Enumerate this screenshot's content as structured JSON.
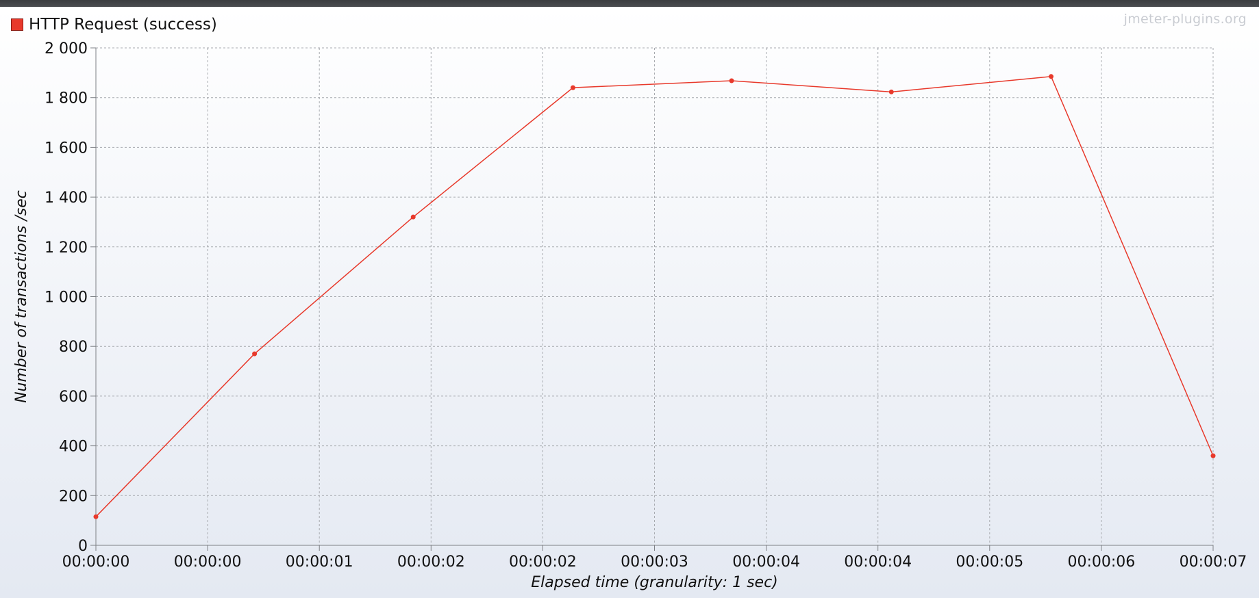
{
  "watermark": "jmeter-plugins.org",
  "colors": {
    "series": "#e8392b",
    "grid": "#a8abb0",
    "axis": "#7d8085",
    "plot_bg_top": "#ffffff",
    "plot_bg_bottom": "#e4e9f2"
  },
  "chart_data": {
    "type": "line",
    "title": "",
    "xlabel": "Elapsed time (granularity: 1 sec)",
    "ylabel": "Number of transactions /sec",
    "ylim": [
      0,
      2000
    ],
    "y_ticks": [
      "0",
      "200",
      "400",
      "600",
      "800",
      "1 000",
      "1 200",
      "1 400",
      "1 600",
      "1 800",
      "2 000"
    ],
    "x_ticks": [
      "00:00:00",
      "00:00:00",
      "00:00:01",
      "00:00:02",
      "00:00:02",
      "00:00:03",
      "00:00:04",
      "00:00:04",
      "00:00:05",
      "00:00:06",
      "00:00:07"
    ],
    "grid": true,
    "legend_position": "top-left",
    "series": [
      {
        "name": "HTTP Request (success)",
        "color": "#e8392b",
        "points": [
          {
            "x": 0.0,
            "y": 115
          },
          {
            "x": 1.42,
            "y": 770
          },
          {
            "x": 2.84,
            "y": 1320
          },
          {
            "x": 4.27,
            "y": 1840
          },
          {
            "x": 5.69,
            "y": 1868
          },
          {
            "x": 7.12,
            "y": 1823
          },
          {
            "x": 8.55,
            "y": 1885
          },
          {
            "x": 10.0,
            "y": 360
          }
        ]
      }
    ]
  }
}
